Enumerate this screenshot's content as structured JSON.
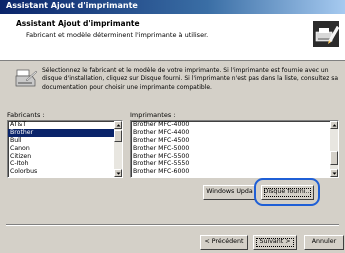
{
  "window": {
    "title": "Assistant Ajout d'imprimante"
  },
  "header": {
    "title": "Assistant Ajout d'imprimante",
    "subtitle": "Fabricant et modèle déterminent l'imprimante à utiliser."
  },
  "intro": {
    "text": "Sélectionnez le fabricant et le modèle de votre imprimante. Si l'imprimante est fournie avec un disque d'installation, cliquez sur Disque fourni. Si l'imprimante n'est pas dans la liste, consultez sa documentation pour choisir une imprimante compatible."
  },
  "manufacturers": {
    "label": "Fabricants :",
    "items": [
      "AT&T",
      "Brother",
      "Bull",
      "Canon",
      "Citizen",
      "C-Itoh",
      "Colorbus"
    ],
    "selected": "Brother"
  },
  "printers": {
    "label": "Imprimantes :",
    "items": [
      "Brother MFC-4000",
      "Brother MFC-4400",
      "Brother MFC-4500",
      "Brother MFC-5000",
      "Brother MFC-5500",
      "Brother MFC-5550",
      "Brother MFC-6000"
    ]
  },
  "buttons": {
    "windows_update": "Windows Upda",
    "have_disk_prefix": "",
    "have_disk_ul": "D",
    "have_disk_rest": "isque fourni...",
    "back_ul": "< P",
    "back_rest": "récédent",
    "next_ul": "S",
    "next_rest": "uivant >",
    "cancel": "Annuler"
  },
  "colors": {
    "title_bar": "#0a246a",
    "selection": "#0a246a",
    "highlight_ring": "#1f5fd6",
    "dialog_face": "#d4d0c8"
  },
  "icons": {
    "header": "printer-wizard-icon",
    "intro": "printer-icon"
  }
}
